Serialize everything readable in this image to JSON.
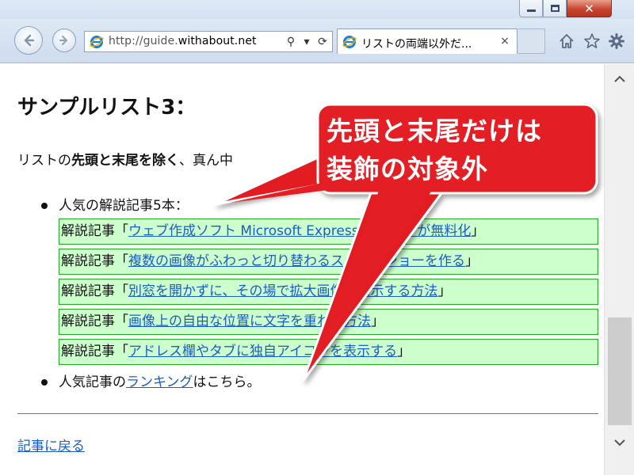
{
  "browser": {
    "address": {
      "prefix": "http://guide.",
      "host": "withabout.net"
    },
    "tab_title": "リストの両端以外だ...",
    "tab_close_glyph": "×",
    "window_close_glyph": "✕",
    "address_search_glyph": "⚲",
    "address_dropdown_glyph": "▾",
    "address_refresh_glyph": "⟳"
  },
  "page": {
    "title": "サンプルリスト3：",
    "intro": {
      "part1": "リストの",
      "bold": "先頭と末尾を除く",
      "part2": "、真ん中"
    },
    "list": {
      "item1_label": "人気の解説記事5本：",
      "articles": [
        {
          "prefix": "解説記事「",
          "link": "ウェブ作成ソフト Microsoft Expression Web が無料化",
          "suffix": "」"
        },
        {
          "prefix": "解説記事「",
          "link": "複数の画像がふわっと切り替わるスライドショーを作る",
          "suffix": "」"
        },
        {
          "prefix": "解説記事「",
          "link": "別窓を開かずに、その場で拡大画像を表示する方法",
          "suffix": "」"
        },
        {
          "prefix": "解説記事「",
          "link": "画像上の自由な位置に文字を重ねる方法",
          "suffix": "」"
        },
        {
          "prefix": "解説記事「",
          "link": "アドレス欄やタブに独自アイコンを表示する",
          "suffix": "」"
        }
      ],
      "item2": {
        "prefix": "人気記事の",
        "link": "ランキング",
        "suffix": "はこちら。"
      }
    },
    "back_link": "記事に戻る"
  },
  "callout": {
    "line1": "先頭と末尾だけは",
    "line2": "装飾の対象外",
    "color": "#e31e24"
  }
}
